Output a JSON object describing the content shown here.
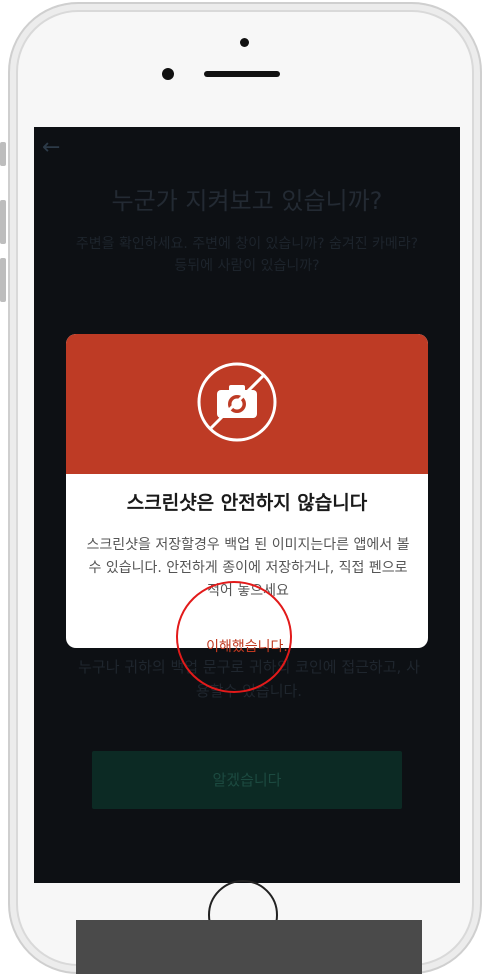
{
  "background": {
    "back_arrow": "←",
    "title": "누군가 지켜보고 있습니까?",
    "subtitle": "주변을 확인하세요. 주변에 창이 있습니까? 숨겨진 카메라? 등뒤에 사람이 있습니까?",
    "bottom_text": "누구나 귀하의 백업 문구로 귀하의 코인에 접근하고, 사용할수 있습니다.",
    "button_label": "알겠습니다"
  },
  "modal": {
    "icon": "no-camera-icon",
    "title": "스크린샷은 안전하지 않습니다",
    "message": "스크린샷을 저장할경우 백업 된 이미지는다른 앱에서 볼수 있습니다. 안전하게 종이에 저장하거나, 직접 펜으로 적어 놓으세요",
    "confirm_label": "이해했습니다."
  },
  "colors": {
    "modal_header": "#be3b25",
    "confirm_text": "#c0381f",
    "screen_bg": "#0d1014",
    "annotation": "#e21a1a"
  }
}
